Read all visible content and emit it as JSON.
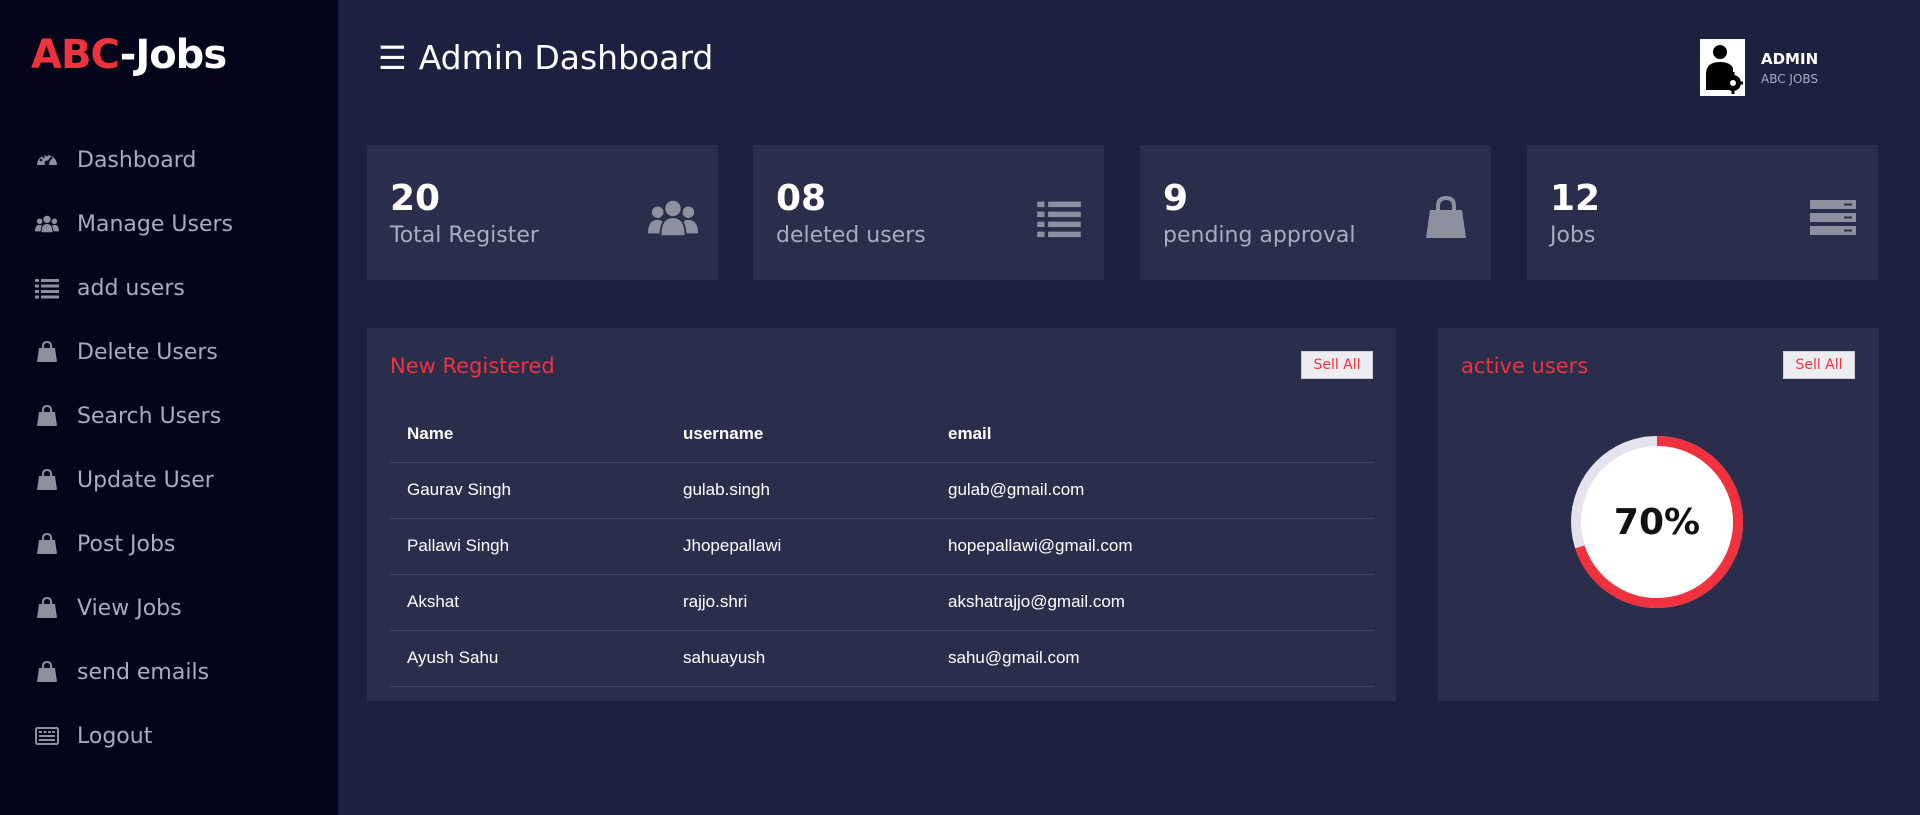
{
  "brand": {
    "part1": "ABC",
    "part2": "-Jobs"
  },
  "sidebar": {
    "items": [
      {
        "label": "Dashboard",
        "icon": "dashboard-gauge-icon"
      },
      {
        "label": "Manage Users",
        "icon": "users-icon"
      },
      {
        "label": "add users",
        "icon": "list-icon"
      },
      {
        "label": "Delete Users",
        "icon": "shopping-bag-icon"
      },
      {
        "label": "Search Users",
        "icon": "shopping-bag-icon"
      },
      {
        "label": "Update User",
        "icon": "shopping-bag-icon"
      },
      {
        "label": "Post Jobs",
        "icon": "shopping-bag-icon"
      },
      {
        "label": "View Jobs",
        "icon": "shopping-bag-icon"
      },
      {
        "label": "send emails",
        "icon": "shopping-bag-icon"
      },
      {
        "label": "Logout",
        "icon": "keyboard-icon"
      }
    ]
  },
  "header": {
    "menu_glyph": "☰",
    "title": "Admin Dashboard",
    "user": {
      "name": "ADMIN",
      "org": "ABC JOBS",
      "icon": "admin-avatar-icon"
    }
  },
  "cards": [
    {
      "value": "20",
      "label": "Total Register",
      "icon": "users-icon"
    },
    {
      "value": "08",
      "label": "deleted users",
      "icon": "list-icon"
    },
    {
      "value": "9",
      "label": "pending approval",
      "icon": "shopping-bag-icon"
    },
    {
      "value": "12",
      "label": "Jobs",
      "icon": "server-icon"
    }
  ],
  "new_registered": {
    "title": "New Registered",
    "button_label": "Sell All",
    "columns": [
      "Name",
      "username",
      "email"
    ],
    "rows": [
      [
        "Gaurav Singh",
        "gulab.singh",
        "gulab@gmail.com"
      ],
      [
        "Pallawi Singh",
        "Jhopepallawi",
        "hopepallawi@gmail.com"
      ],
      [
        "Akshat",
        "rajjo.shri",
        "akshatrajjo@gmail.com"
      ],
      [
        "Ayush Sahu",
        "sahuayush",
        "sahu@gmail.com"
      ]
    ]
  },
  "active_users": {
    "title": "active users",
    "button_label": "Sell All",
    "percent_label": "70%",
    "percent": 70
  },
  "colors": {
    "accent": "#f0323f",
    "background": "#1d2140",
    "sidebar": "#03061b",
    "card": "#2a2e4b",
    "muted_text": "#a8acbf",
    "icon_gray": "#8d909f"
  }
}
